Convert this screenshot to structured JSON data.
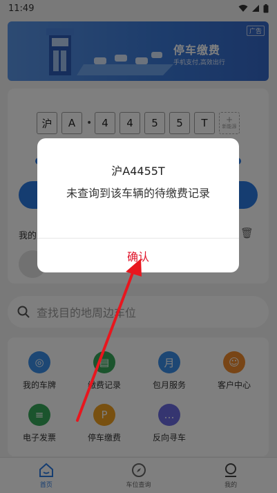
{
  "status_bar": {
    "time": "11:49"
  },
  "banner": {
    "ad_tag": "广告",
    "title": "停车缴费",
    "subtitle": "手机支付,高效出行"
  },
  "plate": {
    "chars": [
      "沪",
      "A",
      "4",
      "4",
      "5",
      "5",
      "T"
    ],
    "dot": "•",
    "new_energy_label": "新能源",
    "my_plates_label": "我的"
  },
  "search": {
    "placeholder": "查找目的地周边车位"
  },
  "services": [
    {
      "label": "我的车牌",
      "icon": "steering-wheel-icon",
      "color": "#3b8fe8"
    },
    {
      "label": "缴费记录",
      "icon": "receipt-icon",
      "color": "#36a85a"
    },
    {
      "label": "包月服务",
      "icon": "ticket-icon",
      "color": "#3b8fe8"
    },
    {
      "label": "客户中心",
      "icon": "person-icon",
      "color": "#f08a2c"
    },
    {
      "label": "电子发票",
      "icon": "invoice-icon",
      "color": "#36a85a"
    },
    {
      "label": "停车缴费",
      "icon": "parking-icon",
      "color": "#f0a020"
    },
    {
      "label": "反向寻车",
      "icon": "chat-icon",
      "color": "#6a6ae0"
    }
  ],
  "tabs": [
    {
      "label": "首页",
      "icon": "home-icon"
    },
    {
      "label": "车位查询",
      "icon": "compass-icon"
    },
    {
      "label": "我的",
      "icon": "profile-icon"
    }
  ],
  "dialog": {
    "title": "沪A4455T",
    "message": "未查询到该车辆的待缴费记录",
    "confirm": "确认"
  },
  "colors": {
    "accent": "#2a7ae2",
    "confirm": "#e0142a",
    "arrow": "#e8161e"
  }
}
